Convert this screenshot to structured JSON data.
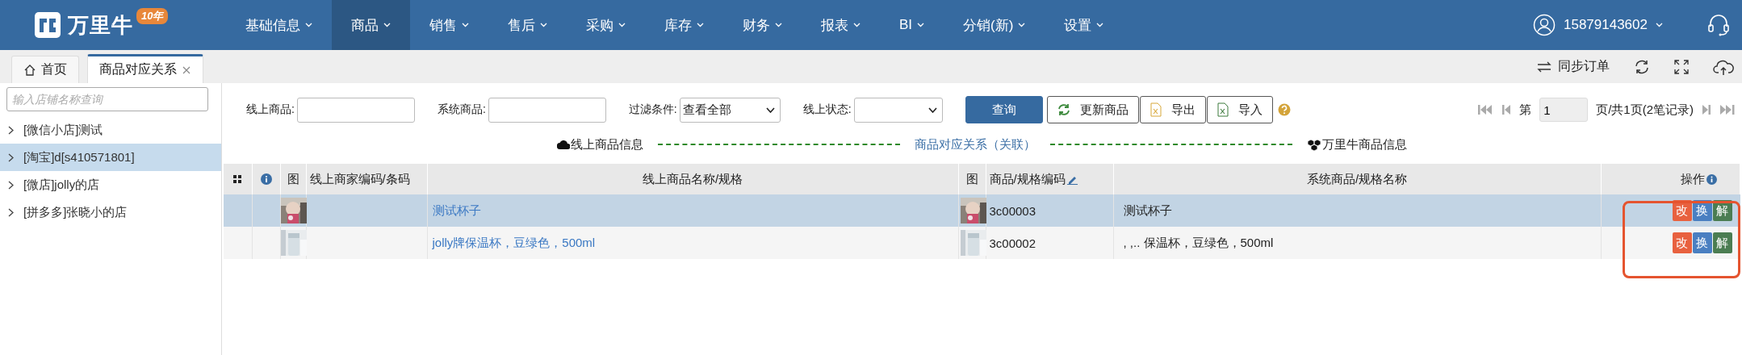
{
  "header": {
    "brand": "万里牛",
    "badge": "10年",
    "nav": [
      {
        "label": "基础信息",
        "selected": false
      },
      {
        "label": "商品",
        "selected": true
      },
      {
        "label": "销售",
        "selected": false
      },
      {
        "label": "售后",
        "selected": false
      },
      {
        "label": "采购",
        "selected": false
      },
      {
        "label": "库存",
        "selected": false
      },
      {
        "label": "财务",
        "selected": false
      },
      {
        "label": "报表",
        "selected": false
      },
      {
        "label": "BI",
        "selected": false
      },
      {
        "label": "分销(新)",
        "selected": false
      },
      {
        "label": "设置",
        "selected": false
      }
    ],
    "user": "15879143602"
  },
  "tabs": [
    {
      "label": "首页",
      "selected": false,
      "kind": "home"
    },
    {
      "label": "商品对应关系",
      "selected": true,
      "kind": "closable"
    }
  ],
  "tab_actions": {
    "sync": "同步订单"
  },
  "sidebar": {
    "search": {
      "placeholder": "输入店铺名称查询"
    },
    "items": [
      {
        "label": "[微信小店]测试",
        "selected": false
      },
      {
        "label": "[淘宝]d[s410571801]",
        "selected": true
      },
      {
        "label": "[微店]jolly的店",
        "selected": false
      },
      {
        "label": "[拼多多]张晓小的店",
        "selected": false
      }
    ]
  },
  "filters": [
    {
      "kind": "text",
      "label": "线上商品:"
    },
    {
      "kind": "text",
      "label": "系统商品:"
    },
    {
      "kind": "select",
      "label": "过滤条件:",
      "value": "查看全部"
    },
    {
      "kind": "select",
      "label": "线上状态:"
    }
  ],
  "buttons": [
    {
      "kind": "primary",
      "label": "查询"
    },
    {
      "kind": "refresh",
      "label": "更新商品"
    },
    {
      "kind": "export",
      "label": "导出"
    },
    {
      "kind": "import",
      "label": "导入"
    }
  ],
  "pager": {
    "prefix": "第",
    "page": "1",
    "suffix": "页/共1页(2笔记录)"
  },
  "relation": {
    "left": "线上商品信息",
    "middle": "商品对应关系（关联）",
    "right": "万里牛商品信息"
  },
  "table": {
    "columns": [
      "图",
      "线上商家编码/条码",
      "线上商品名称/规格",
      "图",
      "商品/规格编码",
      "系统商品/规格名称",
      "操作"
    ],
    "rows": [
      {
        "selected": true,
        "online_name": "测试杯子",
        "code": "3c00003",
        "system_name": "测试杯子",
        "actions": [
          {
            "label": "改",
            "color": "#e8613f"
          },
          {
            "label": "换",
            "color": "#4a7fc1"
          },
          {
            "label": "解",
            "color": "#4b7d52"
          }
        ]
      },
      {
        "selected": false,
        "online_name": "jolly牌保温杯，豆绿色，500ml",
        "code": "3c00002",
        "system_name": ", ,.. 保温杯，豆绿色，500ml",
        "actions": [
          {
            "label": "改",
            "color": "#e8613f"
          },
          {
            "label": "换",
            "color": "#4a7fc1"
          },
          {
            "label": "解",
            "color": "#4b7d52"
          }
        ]
      }
    ],
    "actions_highlighted": true
  }
}
